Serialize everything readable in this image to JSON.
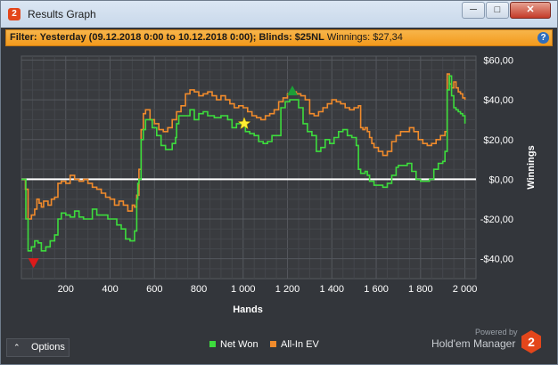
{
  "window": {
    "title": "Results Graph",
    "app_icon_label": "2",
    "buttons": {
      "minimize": "─",
      "maximize": "□",
      "close": "✕"
    }
  },
  "filter": {
    "prefix": "Filter:",
    "date_range": "Yesterday (09.12.2018 0:00 to 10.12.2018 0:00);",
    "blinds": "Blinds: $25NL",
    "winnings": "Winnings: $27,34",
    "help_label": "?"
  },
  "chart_data": {
    "type": "line",
    "xlabel": "Hands",
    "ylabel": "Winnings",
    "xlim": [
      0,
      2050
    ],
    "ylim": [
      -50,
      62
    ],
    "x_ticks": [
      200,
      400,
      600,
      800,
      1000,
      1200,
      1400,
      1600,
      1800,
      2000
    ],
    "x_tick_labels": [
      "200",
      "400",
      "600",
      "800",
      "1 000",
      "1 200",
      "1 400",
      "1 600",
      "1 800",
      "2 000"
    ],
    "y_ticks": [
      60,
      40,
      20,
      0,
      -20,
      -40
    ],
    "y_tick_labels": [
      "$60,00",
      "$40,00",
      "$20,00",
      "$0,00",
      "-$20,00",
      "-$40,00"
    ],
    "grid": true,
    "series": [
      {
        "name": "Net Won",
        "color": "#3ddc3d",
        "points": [
          [
            0,
            0
          ],
          [
            15,
            0
          ],
          [
            20,
            -20
          ],
          [
            30,
            -36
          ],
          [
            45,
            -34
          ],
          [
            60,
            -31
          ],
          [
            75,
            -32
          ],
          [
            90,
            -36
          ],
          [
            110,
            -34
          ],
          [
            130,
            -31
          ],
          [
            150,
            -28
          ],
          [
            165,
            -20
          ],
          [
            180,
            -17
          ],
          [
            200,
            -18
          ],
          [
            220,
            -19
          ],
          [
            240,
            -16
          ],
          [
            260,
            -19
          ],
          [
            280,
            -20
          ],
          [
            300,
            -20
          ],
          [
            320,
            -15
          ],
          [
            340,
            -18
          ],
          [
            370,
            -18
          ],
          [
            390,
            -20
          ],
          [
            410,
            -20
          ],
          [
            430,
            -23
          ],
          [
            450,
            -25
          ],
          [
            470,
            -30
          ],
          [
            490,
            -31
          ],
          [
            510,
            -26
          ],
          [
            520,
            -10
          ],
          [
            525,
            -2
          ],
          [
            530,
            0
          ],
          [
            540,
            20
          ],
          [
            550,
            25
          ],
          [
            560,
            30
          ],
          [
            570,
            30
          ],
          [
            590,
            26
          ],
          [
            610,
            22
          ],
          [
            630,
            17
          ],
          [
            650,
            15
          ],
          [
            665,
            15
          ],
          [
            680,
            18
          ],
          [
            695,
            21
          ],
          [
            700,
            28
          ],
          [
            710,
            32
          ],
          [
            730,
            32
          ],
          [
            760,
            35
          ],
          [
            780,
            30
          ],
          [
            800,
            33
          ],
          [
            820,
            34
          ],
          [
            840,
            32
          ],
          [
            870,
            31
          ],
          [
            900,
            32
          ],
          [
            930,
            30
          ],
          [
            950,
            26
          ],
          [
            970,
            28
          ],
          [
            990,
            28
          ],
          [
            1010,
            24
          ],
          [
            1030,
            23
          ],
          [
            1050,
            22
          ],
          [
            1070,
            19
          ],
          [
            1090,
            18
          ],
          [
            1110,
            19
          ],
          [
            1130,
            22
          ],
          [
            1150,
            22
          ],
          [
            1170,
            36
          ],
          [
            1190,
            39
          ],
          [
            1210,
            40
          ],
          [
            1230,
            40
          ],
          [
            1250,
            36
          ],
          [
            1270,
            28
          ],
          [
            1290,
            24
          ],
          [
            1310,
            22
          ],
          [
            1330,
            14
          ],
          [
            1350,
            16
          ],
          [
            1370,
            20
          ],
          [
            1390,
            18
          ],
          [
            1410,
            21
          ],
          [
            1430,
            24
          ],
          [
            1450,
            25
          ],
          [
            1470,
            22
          ],
          [
            1490,
            21
          ],
          [
            1510,
            17
          ],
          [
            1520,
            5
          ],
          [
            1530,
            3
          ],
          [
            1550,
            4
          ],
          [
            1560,
            2
          ],
          [
            1570,
            -1
          ],
          [
            1590,
            -3
          ],
          [
            1610,
            -3
          ],
          [
            1630,
            -4
          ],
          [
            1650,
            -2
          ],
          [
            1670,
            2
          ],
          [
            1690,
            6
          ],
          [
            1700,
            7
          ],
          [
            1720,
            7
          ],
          [
            1740,
            8
          ],
          [
            1760,
            4
          ],
          [
            1780,
            0
          ],
          [
            1800,
            -1
          ],
          [
            1820,
            -1
          ],
          [
            1840,
            0
          ],
          [
            1860,
            5
          ],
          [
            1880,
            8
          ],
          [
            1900,
            9
          ],
          [
            1910,
            14
          ],
          [
            1920,
            45
          ],
          [
            1930,
            52
          ],
          [
            1940,
            42
          ],
          [
            1950,
            36
          ],
          [
            1960,
            35
          ],
          [
            1970,
            34
          ],
          [
            1980,
            33
          ],
          [
            1990,
            32
          ],
          [
            2000,
            28
          ]
        ]
      },
      {
        "name": "All-In EV",
        "color": "#f08b2c",
        "points": [
          [
            0,
            0
          ],
          [
            15,
            0
          ],
          [
            18,
            -5
          ],
          [
            30,
            -20
          ],
          [
            45,
            -18
          ],
          [
            60,
            -15
          ],
          [
            70,
            -10
          ],
          [
            80,
            -12
          ],
          [
            90,
            -14
          ],
          [
            100,
            -11
          ],
          [
            120,
            -13
          ],
          [
            135,
            -10
          ],
          [
            150,
            -9
          ],
          [
            165,
            -2
          ],
          [
            180,
            -1
          ],
          [
            200,
            -2
          ],
          [
            220,
            2
          ],
          [
            240,
            0
          ],
          [
            260,
            -1
          ],
          [
            280,
            0
          ],
          [
            300,
            -2
          ],
          [
            320,
            -4
          ],
          [
            340,
            -5
          ],
          [
            360,
            -7
          ],
          [
            380,
            -9
          ],
          [
            400,
            -10
          ],
          [
            420,
            -13
          ],
          [
            440,
            -11
          ],
          [
            460,
            -13
          ],
          [
            480,
            -16
          ],
          [
            500,
            -13
          ],
          [
            510,
            -14
          ],
          [
            520,
            -8
          ],
          [
            530,
            5
          ],
          [
            540,
            25
          ],
          [
            550,
            33
          ],
          [
            560,
            35
          ],
          [
            580,
            30
          ],
          [
            600,
            28
          ],
          [
            620,
            25
          ],
          [
            640,
            24
          ],
          [
            660,
            26
          ],
          [
            680,
            30
          ],
          [
            700,
            34
          ],
          [
            720,
            37
          ],
          [
            740,
            43
          ],
          [
            760,
            45
          ],
          [
            780,
            44
          ],
          [
            800,
            42
          ],
          [
            820,
            43
          ],
          [
            840,
            44
          ],
          [
            860,
            42
          ],
          [
            880,
            40
          ],
          [
            900,
            42
          ],
          [
            920,
            40
          ],
          [
            940,
            38
          ],
          [
            960,
            36
          ],
          [
            980,
            37
          ],
          [
            1000,
            36
          ],
          [
            1020,
            34
          ],
          [
            1040,
            32
          ],
          [
            1060,
            31
          ],
          [
            1080,
            30
          ],
          [
            1100,
            32
          ],
          [
            1120,
            33
          ],
          [
            1140,
            35
          ],
          [
            1160,
            39
          ],
          [
            1180,
            41
          ],
          [
            1200,
            43
          ],
          [
            1220,
            44
          ],
          [
            1240,
            43
          ],
          [
            1260,
            42
          ],
          [
            1280,
            40
          ],
          [
            1300,
            33
          ],
          [
            1320,
            32
          ],
          [
            1340,
            34
          ],
          [
            1360,
            36
          ],
          [
            1380,
            38
          ],
          [
            1400,
            40
          ],
          [
            1420,
            39
          ],
          [
            1440,
            38
          ],
          [
            1460,
            36
          ],
          [
            1480,
            35
          ],
          [
            1500,
            36
          ],
          [
            1520,
            37
          ],
          [
            1530,
            26
          ],
          [
            1540,
            25
          ],
          [
            1550,
            26
          ],
          [
            1560,
            24
          ],
          [
            1570,
            21
          ],
          [
            1580,
            18
          ],
          [
            1590,
            16
          ],
          [
            1610,
            14
          ],
          [
            1630,
            12
          ],
          [
            1650,
            14
          ],
          [
            1670,
            19
          ],
          [
            1690,
            22
          ],
          [
            1710,
            24
          ],
          [
            1730,
            24
          ],
          [
            1750,
            26
          ],
          [
            1770,
            24
          ],
          [
            1790,
            20
          ],
          [
            1810,
            18
          ],
          [
            1830,
            17
          ],
          [
            1850,
            18
          ],
          [
            1870,
            20
          ],
          [
            1890,
            22
          ],
          [
            1910,
            24
          ],
          [
            1920,
            53
          ],
          [
            1930,
            48
          ],
          [
            1940,
            46
          ],
          [
            1950,
            49
          ],
          [
            1960,
            46
          ],
          [
            1970,
            44
          ],
          [
            1980,
            43
          ],
          [
            1990,
            41
          ],
          [
            2000,
            40
          ]
        ]
      }
    ],
    "zero_line": true,
    "markers": [
      {
        "type": "star",
        "color": "#ffee33",
        "x": 1005,
        "y": 28
      },
      {
        "type": "max-triangle",
        "color": "#1d9e38",
        "x": 1222,
        "y": 44
      },
      {
        "type": "min-triangle",
        "color": "#dd1a1a",
        "x": 55,
        "y": -42
      }
    ]
  },
  "bottom": {
    "options_label": "Options",
    "legend_net_won": "Net Won",
    "legend_allin_ev": "All-In EV",
    "powered_by": "Powered by",
    "brand_name": "Hold'em Manager",
    "brand_icon_label": "2"
  },
  "colors": {
    "net_won": "#3ddc3d",
    "allin_ev": "#f08b2c",
    "filter_bar": "#f39a1c",
    "plot_bg": "#393b3f"
  }
}
